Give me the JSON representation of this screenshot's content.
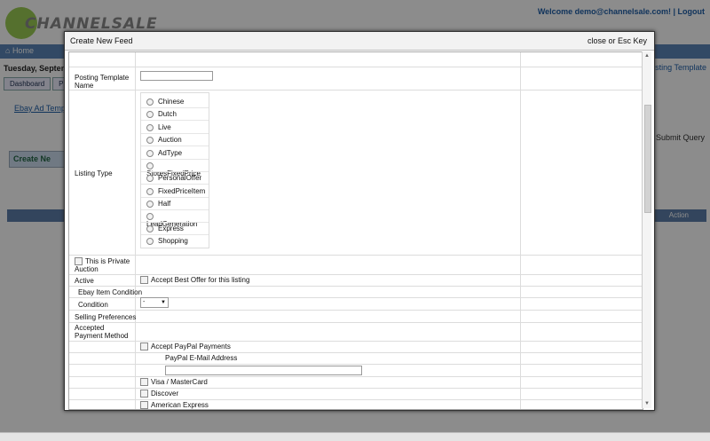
{
  "background": {
    "logo_text": "CHANNELSALE",
    "welcome_text": "Welcome demo@channelsale.com! | Logout",
    "nav_home": "Home",
    "date_text": "Tuesday, Septem",
    "right_tab_text": "osting Template",
    "tabs": [
      "Dashboard",
      "P"
    ],
    "ebay_link": "Ebay Ad Temp",
    "submit_query": "Submit Query",
    "create_new": "Create Ne",
    "action_header": "Action"
  },
  "modal": {
    "title": "Create New Feed",
    "close_label": "close or Esc Key",
    "posting_template_name_label": "Posting Template Name",
    "posting_template_name_value": "",
    "listing_type_label": "Listing Type",
    "listing_types": [
      "Chinese",
      "Dutch",
      "Live",
      "Auction",
      "AdType",
      "StoresFixedPrice",
      "PersonalOffer",
      "FixedPriceItem",
      "Half",
      "LeadGeneration",
      "Express",
      "Shopping"
    ],
    "private_auction_label": "This is Private Auction",
    "active_label": "Active",
    "accept_best_offer_label": "Accept Best Offer for this listing",
    "ebay_item_condition_label": "Ebay Item Condition",
    "condition_label": "Condition",
    "condition_value": "-",
    "selling_preferences_label": "Selling Preferences",
    "accepted_payment_label": "Accepted Payment Method",
    "accept_paypal_label": "Accept PayPal Payments",
    "paypal_email_label": "PayPal E-Mail Address",
    "paypal_email_value": "",
    "visa_label": "Visa / MasterCard",
    "discover_label": "Discover",
    "amex_label": "American Express"
  }
}
